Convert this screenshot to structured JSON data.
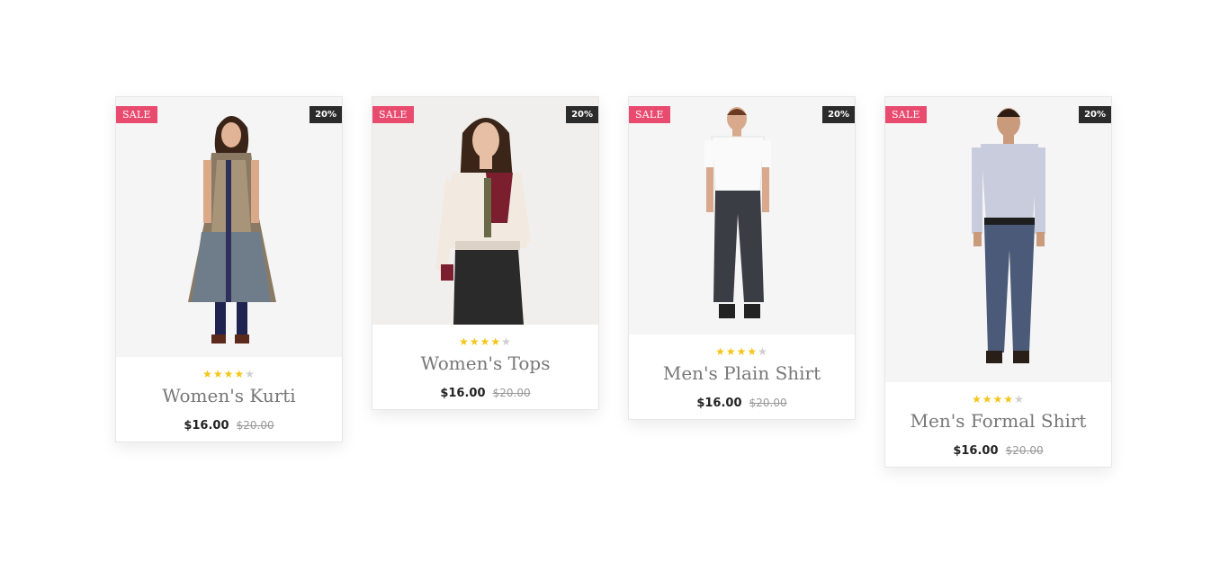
{
  "products": [
    {
      "name": "Women's Kurti",
      "sale_label": "SALE",
      "discount": "20%",
      "price": "$16.00",
      "old_price": "$20.00",
      "rating": 4,
      "max_rating": 5
    },
    {
      "name": "Women's Tops",
      "sale_label": "SALE",
      "discount": "20%",
      "price": "$16.00",
      "old_price": "$20.00",
      "rating": 4,
      "max_rating": 5
    },
    {
      "name": "Men's Plain Shirt",
      "sale_label": "SALE",
      "discount": "20%",
      "price": "$16.00",
      "old_price": "$20.00",
      "rating": 4,
      "max_rating": 5
    },
    {
      "name": "Men's Formal Shirt",
      "sale_label": "SALE",
      "discount": "20%",
      "price": "$16.00",
      "old_price": "$20.00",
      "rating": 4,
      "max_rating": 5
    }
  ],
  "colors": {
    "sale_badge": "#e94b6e",
    "discount_badge": "#2b2b2b",
    "star_active": "#f5c518",
    "star_inactive": "#cfcfcf"
  }
}
